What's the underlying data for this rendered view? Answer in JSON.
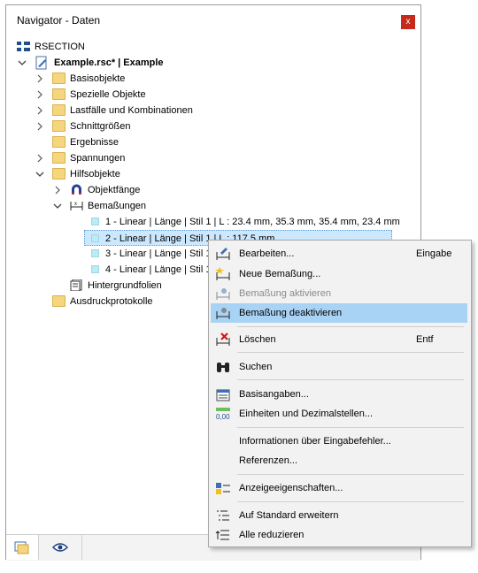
{
  "window": {
    "title": "Navigator - Daten",
    "close_glyph": "x"
  },
  "tree": {
    "root": "RSECTION",
    "file": "Example.rsc* | Example",
    "items": [
      "Basisobjekte",
      "Spezielle Objekte",
      "Lastfälle und Kombinationen",
      "Schnittgrößen",
      "Ergebnisse",
      "Spannungen",
      "Hilfsobjekte"
    ],
    "hilfs": {
      "objektfaenge": "Objektfänge",
      "bemassungen": "Bemaßungen",
      "dims": [
        "1 - Linear | Länge | Stil 1 | L : 23.4 mm, 35.3 mm, 35.4 mm, 23.4 mm",
        "2 - Linear | Länge | Stil 1 | L : 117.5 mm",
        "3 - Linear | Länge | Stil 1",
        "4 - Linear | Länge | Stil 1"
      ],
      "hintergrund": "Hintergrundfolien"
    },
    "ausdruck": "Ausdruckprotokolle"
  },
  "context_menu": {
    "bearbeiten": "Bearbeiten...",
    "bearbeiten_shortcut": "Eingabe",
    "neue": "Neue Bemaßung...",
    "aktivieren": "Bemaßung aktivieren",
    "deaktivieren": "Bemaßung deaktivieren",
    "loeschen": "Löschen",
    "loeschen_shortcut": "Entf",
    "suchen": "Suchen",
    "basisangaben": "Basisangaben...",
    "einheiten": "Einheiten und Dezimalstellen...",
    "einheiten_icon_text": "0,00",
    "informationen": "Informationen über Eingabefehler...",
    "referenzen": "Referenzen...",
    "anzeige": "Anzeigeeigenschaften...",
    "erweitern": "Auf Standard erweitern",
    "reduzieren": "Alle reduzieren"
  },
  "colors": {
    "highlight": "#a9d3f5",
    "selection": "#cce8ff",
    "close": "#c42b1c"
  }
}
